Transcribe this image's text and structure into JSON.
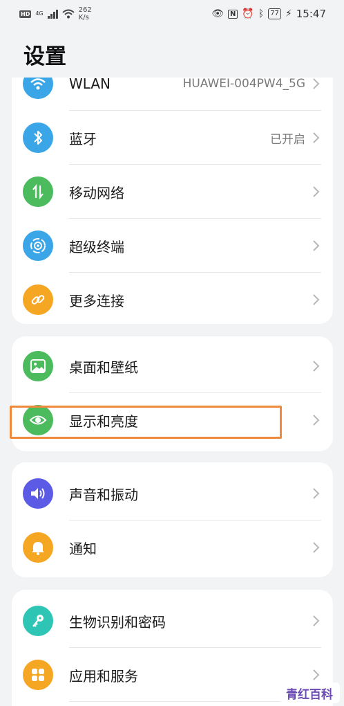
{
  "status_bar": {
    "hd": "HD",
    "network_gen": "4G",
    "speed_value": "262",
    "speed_unit": "K/s",
    "battery": "77",
    "time": "15:47"
  },
  "page_title": "设置",
  "groups": [
    {
      "items": [
        {
          "label": "WLAN",
          "value": "HUAWEI-004PW4_5G",
          "icon": "wifi-icon",
          "color": "#3aa6e8"
        },
        {
          "label": "蓝牙",
          "value": "已开启",
          "icon": "bluetooth-icon",
          "color": "#3aa6e8"
        },
        {
          "label": "移动网络",
          "value": "",
          "icon": "mobile-data-icon",
          "color": "#4bbb5e"
        },
        {
          "label": "超级终端",
          "value": "",
          "icon": "super-device-icon",
          "color": "#3aa6e8"
        },
        {
          "label": "更多连接",
          "value": "",
          "icon": "link-icon",
          "color": "#f5a623"
        }
      ]
    },
    {
      "items": [
        {
          "label": "桌面和壁纸",
          "value": "",
          "icon": "wallpaper-icon",
          "color": "#4bbb5e"
        },
        {
          "label": "显示和亮度",
          "value": "",
          "icon": "eye-icon",
          "color": "#4bbb5e"
        }
      ]
    },
    {
      "items": [
        {
          "label": "声音和振动",
          "value": "",
          "icon": "speaker-icon",
          "color": "#5b5be6"
        },
        {
          "label": "通知",
          "value": "",
          "icon": "bell-icon",
          "color": "#f5a623"
        }
      ]
    },
    {
      "items": [
        {
          "label": "生物识别和密码",
          "value": "",
          "icon": "key-icon",
          "color": "#2fc5b4"
        },
        {
          "label": "应用和服务",
          "value": "",
          "icon": "apps-icon",
          "color": "#f5a623"
        }
      ]
    }
  ],
  "watermark": "青红百科"
}
